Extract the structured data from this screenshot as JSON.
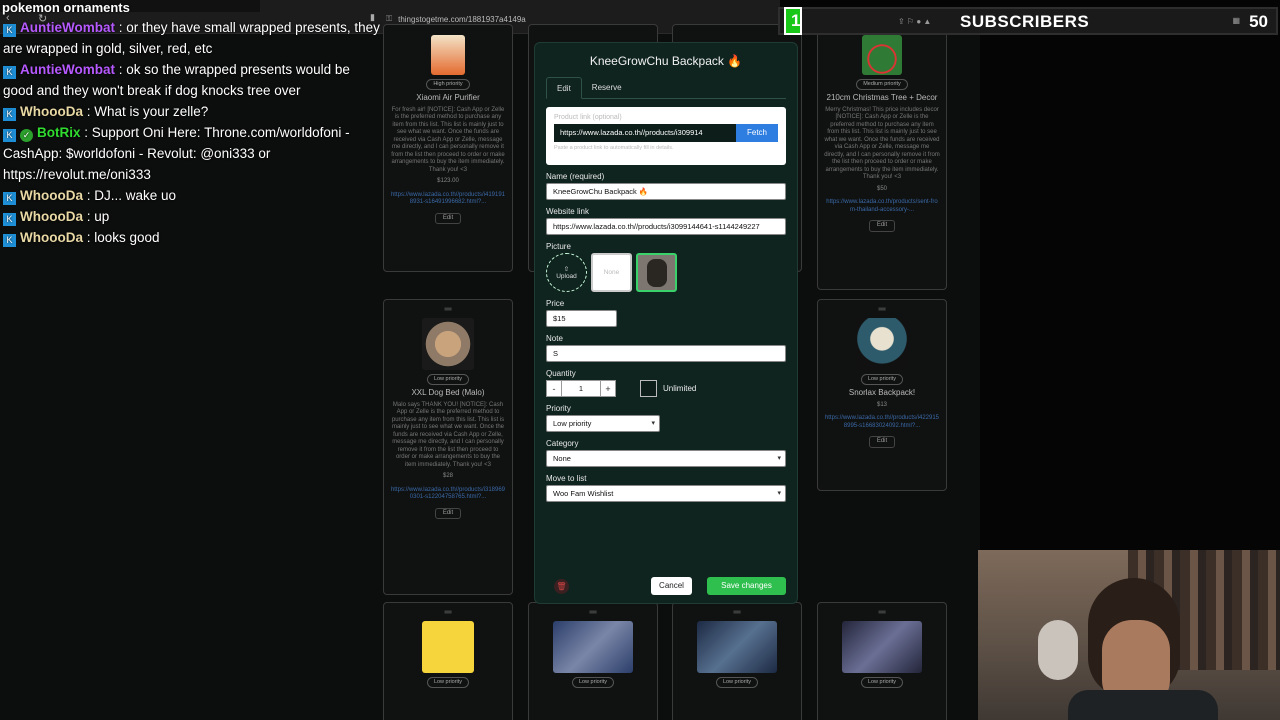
{
  "browser": {
    "url": "thingstogetme.com/1881937a4149a"
  },
  "chat": {
    "top_line": "pokemon ornaments",
    "messages": [
      {
        "user": "AuntieWombat",
        "text": " : or they have small wrapped presents, they are wrapped in gold, silver, red, etc",
        "cls": "u-auntie"
      },
      {
        "user": "AuntieWombat",
        "text": " : ok so the wrapped presents would be good and they won't break if dog knocks tree over",
        "cls": "u-auntie"
      },
      {
        "user": "WhoooDa",
        "text": " : What is your zelle?",
        "cls": "u-whoooda"
      },
      {
        "user": "BotRix",
        "text": " : Support Oni Here: Throne.com/worldofoni - CashApp: $worldofoni - Revolut: @oni333 or https://revolut.me/oni333",
        "cls": "u-botrix"
      },
      {
        "user": "WhoooDa",
        "text": " : DJ... wake uo",
        "cls": "u-whoooda"
      },
      {
        "user": "WhoooDa",
        "text": " : up",
        "cls": "u-whoooda"
      },
      {
        "user": "WhoooDa",
        "text": " : looks good",
        "cls": "u-whoooda"
      }
    ]
  },
  "subs_widget": {
    "left_number": "1",
    "label": "SUBSCRIBERS",
    "count": "50"
  },
  "cards": {
    "air_purifier": {
      "priority": "High priority",
      "title": "Xiaomi Air Purifier",
      "desc": "For fresh air! [NOTICE]: Cash App or Zelle is the preferred method to purchase any item from this list. This list is mainly just to see what we want. Once the funds are received via Cash App or Zelle, message me directly, and I can personally remove it from the list then proceed to order or make arrangements to buy the item immediately. Thank you! <3",
      "price": "$123.00",
      "link": "https://www.lazada.co.th//products/i4191918931-s16491996682.html?...",
      "edit": "Edit"
    },
    "tree": {
      "priority": "Medium priority",
      "title": "210cm Christmas Tree + Decor",
      "desc": "Merry Christmas! This price includes decor [NOTICE]: Cash App or Zelle is the preferred method to purchase any item from this list. This list is mainly just to see what we want. Once the funds are received via Cash App or Zelle, message me directly, and I can personally remove it from the list then proceed to order or make arrangements to buy the item immediately. Thank you! <3",
      "price": "$50",
      "link": "https://www.lazada.co.th/products/sent-from-thailand-accessory-...",
      "edit": "Edit"
    },
    "dog_bed": {
      "priority": "Low priority",
      "title": "XXL Dog Bed (Malo)",
      "desc": "Malo says THANK YOU! [NOTICE]: Cash App or Zelle is the preferred method to purchase any item from this list. This list is mainly just to see what we want. Once the funds are received via Cash App or Zelle, message me directly, and I can personally remove it from the list then proceed to order or make arrangements to buy the item immediately. Thank you! <3",
      "price": "$28",
      "link": "https://www.lazada.co.th//products/i3189690301-s12204758765.html?...",
      "edit": "Edit"
    },
    "snorlax": {
      "priority": "Low priority",
      "title": "Snorlax Backpack!",
      "price": "$13",
      "link": "https://www.lazada.co.th//products/i4229158995-s16683024092.html?...",
      "edit": "Edit"
    },
    "bottom1": {
      "priority": "Low priority"
    },
    "bottom2": {
      "priority": "Low priority"
    },
    "bottom3": {
      "priority": "Low priority"
    },
    "bottom4": {
      "priority": "Low priority"
    }
  },
  "modal": {
    "title": "KneeGrowChu Backpack",
    "tabs": [
      "Edit",
      "Reserve"
    ],
    "product_link_label": "Product link (optional)",
    "product_link_value": "https://www.lazada.co.th//products/i309914",
    "fetch_label": "Fetch",
    "fetch_hint": "Paste a product link to automatically fill in details.",
    "name_label": "Name (required)",
    "name_value": "KneeGrowChu Backpack",
    "website_label": "Website link",
    "website_value": "https://www.lazada.co.th//products/i3099144641-s1144249227",
    "picture_label": "Picture",
    "pic_upload": "Upload",
    "pic_none": "None",
    "price_label": "Price",
    "price_value": "$15",
    "note_label": "Note",
    "note_value": "S",
    "quantity_label": "Quantity",
    "qty_minus": "-",
    "qty_value": "1",
    "qty_plus": "+",
    "unlimited_label": "Unlimited",
    "priority_label": "Priority",
    "priority_value": "Low priority",
    "category_label": "Category",
    "category_value": "None",
    "move_label": "Move to list",
    "move_value": "Woo Fam Wishlist",
    "cancel": "Cancel",
    "save": "Save changes"
  },
  "colors": {
    "modal_bg": "#0f241f",
    "save_green": "#2fbf4e",
    "fetch_blue": "#2e7de0",
    "subs_green": "#18c718"
  }
}
